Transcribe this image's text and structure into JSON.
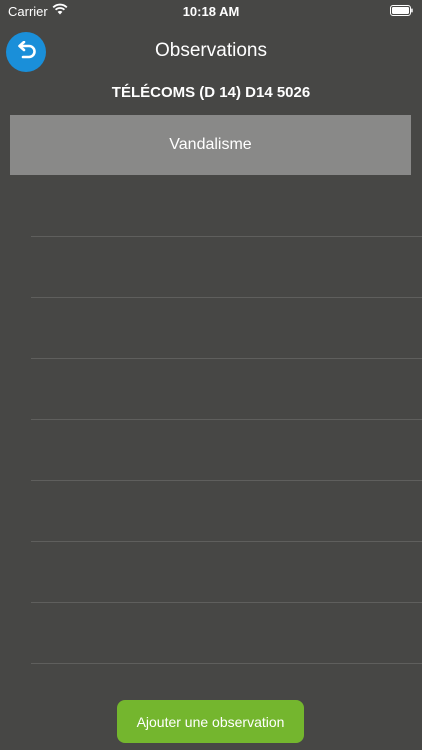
{
  "status_bar": {
    "carrier": "Carrier",
    "time": "10:18 AM",
    "wifi_icon": "wifi-icon",
    "battery_icon": "battery-icon"
  },
  "header": {
    "back_icon": "undo-arrow-icon",
    "title": "Observations",
    "subtitle": "TÉLÉCOMS (D 14) D14 5026"
  },
  "observations": {
    "items": [
      {
        "label": "Vandalisme",
        "selected": true
      }
    ],
    "empty_rows": 8
  },
  "footer": {
    "add_label": "Ajouter une observation"
  },
  "colors": {
    "background": "#474745",
    "back_button": "#1a8fd9",
    "selected_row": "#898988",
    "add_button": "#74b62e"
  }
}
